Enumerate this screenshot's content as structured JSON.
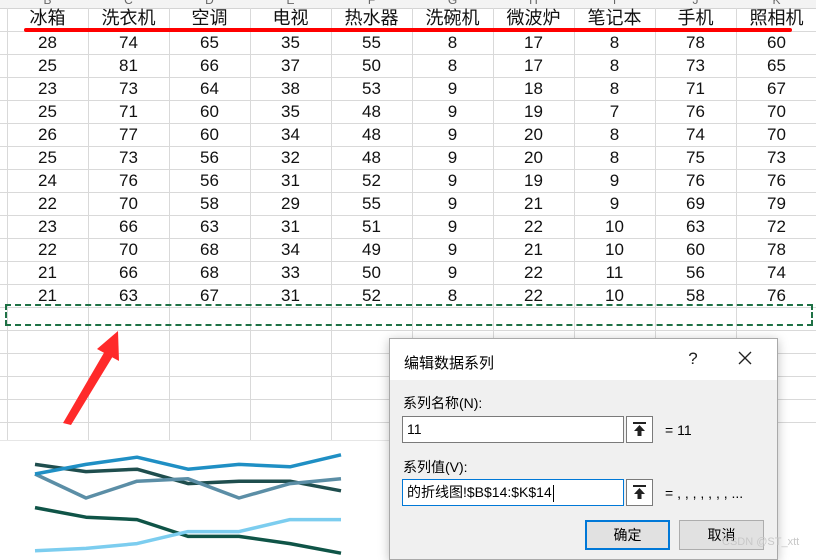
{
  "sheet": {
    "column_letters": [
      "B",
      "C",
      "D",
      "E",
      "F",
      "G",
      "H",
      "I",
      "J",
      "K"
    ],
    "headers": [
      "冰箱",
      "洗衣机",
      "空调",
      "电视",
      "热水器",
      "洗碗机",
      "微波炉",
      "笔记本",
      "手机",
      "照相机"
    ],
    "rows": [
      [
        "28",
        "74",
        "65",
        "35",
        "55",
        "8",
        "17",
        "8",
        "78",
        "60"
      ],
      [
        "25",
        "81",
        "66",
        "37",
        "50",
        "8",
        "17",
        "8",
        "73",
        "65"
      ],
      [
        "23",
        "73",
        "64",
        "38",
        "53",
        "9",
        "18",
        "8",
        "71",
        "67"
      ],
      [
        "25",
        "71",
        "60",
        "35",
        "48",
        "9",
        "19",
        "7",
        "76",
        "70"
      ],
      [
        "26",
        "77",
        "60",
        "34",
        "48",
        "9",
        "20",
        "8",
        "74",
        "70"
      ],
      [
        "25",
        "73",
        "56",
        "32",
        "48",
        "9",
        "20",
        "8",
        "75",
        "73"
      ],
      [
        "24",
        "76",
        "56",
        "31",
        "52",
        "9",
        "19",
        "9",
        "76",
        "76"
      ],
      [
        "22",
        "70",
        "58",
        "29",
        "55",
        "9",
        "21",
        "9",
        "69",
        "79"
      ],
      [
        "23",
        "66",
        "63",
        "31",
        "51",
        "9",
        "22",
        "10",
        "63",
        "72"
      ],
      [
        "22",
        "70",
        "68",
        "34",
        "49",
        "9",
        "21",
        "10",
        "60",
        "78"
      ],
      [
        "21",
        "66",
        "68",
        "33",
        "50",
        "9",
        "22",
        "11",
        "56",
        "74"
      ],
      [
        "21",
        "63",
        "67",
        "31",
        "52",
        "8",
        "22",
        "10",
        "58",
        "76"
      ]
    ]
  },
  "chart_data": {
    "type": "line",
    "title": "",
    "xlabel": "",
    "ylabel": "",
    "x": [
      1,
      2,
      3,
      4,
      5,
      6,
      7
    ],
    "series": [
      {
        "values": [
          34,
          31,
          32,
          26,
          27,
          27,
          23
        ],
        "color": "#1f4e4e"
      },
      {
        "values": [
          30,
          20,
          27,
          28,
          20,
          26,
          28
        ],
        "color": "#5b8ea6"
      },
      {
        "values": [
          30,
          34,
          37,
          32,
          34,
          33,
          38
        ],
        "color": "#1f8fc4"
      },
      {
        "values": [
          16,
          12,
          11,
          4,
          4,
          1,
          -3
        ],
        "color": "#0f5447"
      },
      {
        "values": [
          -2,
          -1,
          1,
          6,
          6,
          11,
          11
        ],
        "color": "#7ccdef"
      }
    ]
  },
  "dialog": {
    "title": "编辑数据系列",
    "help": "?",
    "series_name_label": "系列名称(N):",
    "series_name_value": "11",
    "series_name_eq": "= 11",
    "series_values_label": "系列值(V):",
    "series_values_value": "的折线图!$B$14:$K$14",
    "series_values_eq": "= , , , , , , , ...",
    "ok_label": "确定",
    "cancel_label": "取消"
  },
  "watermark": "CSDN @ST_xtt"
}
